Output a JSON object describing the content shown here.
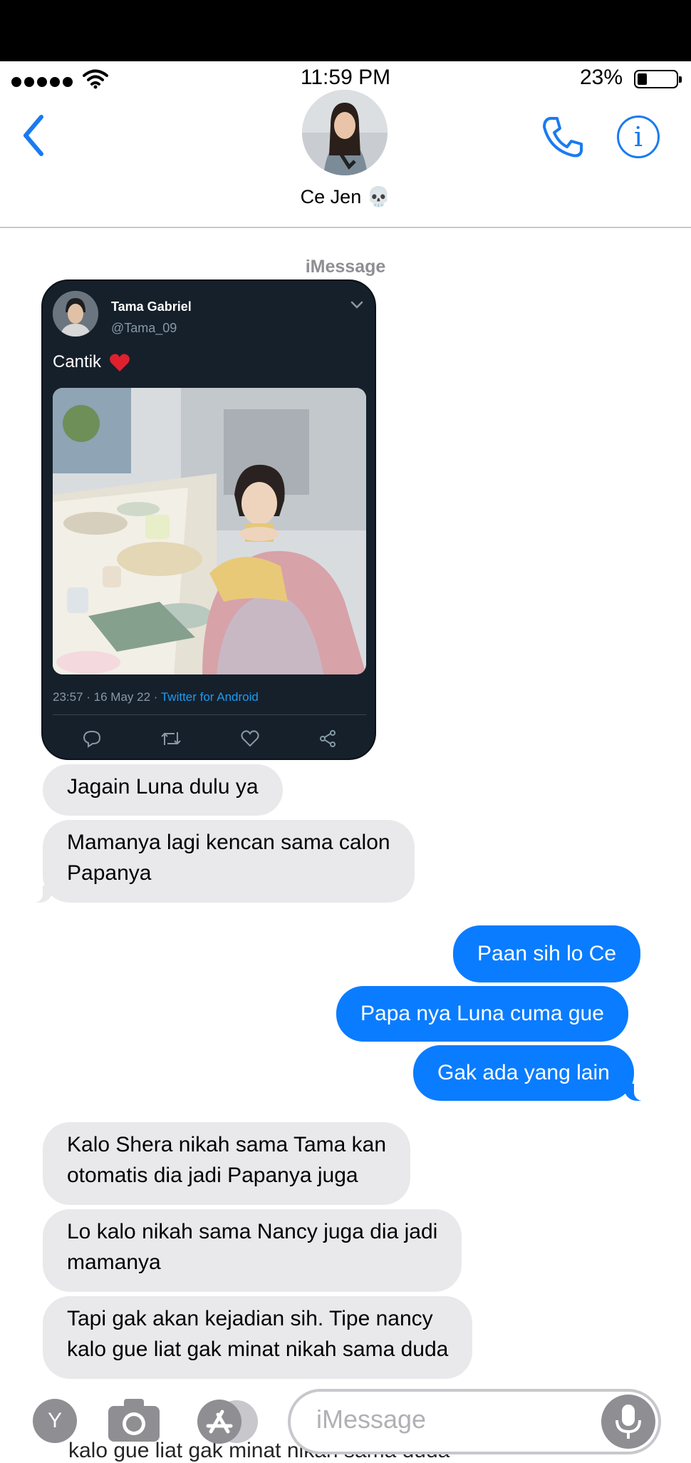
{
  "status_bar": {
    "time": "11:59 PM",
    "battery_percent": "23%",
    "battery_level": 0.23
  },
  "header": {
    "contact_name": "Ce Jen 💀",
    "service_label": "iMessage"
  },
  "tweet": {
    "author_name": "Tama Gabriel",
    "author_handle": "@Tama_09",
    "text": "Cantik",
    "timestamp": "23:57 · 16 May 22 · ",
    "source": "Twitter for Android"
  },
  "messages": [
    {
      "from": "contact",
      "text": "Jagain Luna dulu ya"
    },
    {
      "from": "contact",
      "lines": [
        "Mamanya lagi kencan sama calon",
        "Papanya"
      ]
    },
    {
      "from": "me",
      "text": "Paan sih lo Ce"
    },
    {
      "from": "me",
      "text": "Papa nya Luna cuma gue"
    },
    {
      "from": "me",
      "text": "Gak ada yang lain"
    },
    {
      "from": "contact",
      "lines": [
        "Kalo Shera nikah sama Tama kan",
        "otomatis dia jadi Papanya juga"
      ]
    },
    {
      "from": "contact",
      "lines": [
        "Lo kalo nikah sama Nancy juga dia jadi",
        "mamanya"
      ]
    },
    {
      "from": "contact",
      "lines": [
        "Tapi gak akan kejadian sih. Tipe nancy",
        "kalo gue liat gak minat nikah sama duda"
      ]
    }
  ],
  "input_bar": {
    "app_button_label": "Y",
    "placeholder": "iMessage"
  },
  "colors": {
    "sent_bubble": "#0a7cff",
    "received_bubble": "#e9e9eb",
    "accent": "#1a7bf0",
    "tweet_bg": "#15202b"
  },
  "icons": [
    "signal-dots-icon",
    "wifi-icon",
    "battery-icon",
    "back-chevron-icon",
    "phone-icon",
    "info-icon",
    "camera-icon",
    "app-store-icon",
    "microphone-icon",
    "reply-icon",
    "retweet-icon",
    "like-icon",
    "share-icon"
  ]
}
